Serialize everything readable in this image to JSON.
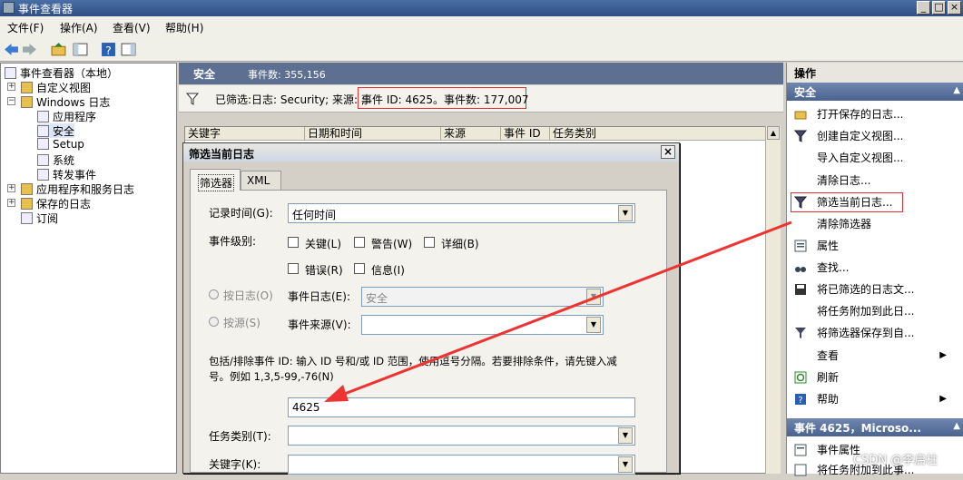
{
  "window": {
    "title": "事件查看器"
  },
  "menu": [
    "文件(F)",
    "操作(A)",
    "查看(V)",
    "帮助(H)"
  ],
  "tree": {
    "root": "事件查看器（本地）",
    "custom_views": "自定义视图",
    "windows_logs": "Windows 日志",
    "application": "应用程序",
    "security": "安全",
    "setup": "Setup",
    "system": "系统",
    "forwarded": "转发事件",
    "app_service_logs": "应用程序和服务日志",
    "saved_logs": "保存的日志",
    "subscriptions": "订阅"
  },
  "center": {
    "section_title": "安全",
    "event_count_label": "事件数: 355,156",
    "filter_text": "已筛选:日志: Security; 来源: ;",
    "filter_highlight": "事件 ID: 4625。事件数: 177,007",
    "columns": [
      "关键字",
      "日期和时间",
      "来源",
      "事件 ID",
      "任务类别"
    ]
  },
  "dialog": {
    "title": "筛选当前日志",
    "tabs": [
      "筛选器",
      "XML"
    ],
    "logged_label": "记录时间(G):",
    "logged_value": "任何时间",
    "level_label": "事件级别:",
    "levels": [
      "关键(L)",
      "警告(W)",
      "详细(B)",
      "错误(R)",
      "信息(I)"
    ],
    "by_log": "按日志(O)",
    "event_log_label": "事件日志(E):",
    "event_log_value": "安全",
    "by_source": "按源(S)",
    "event_source_label": "事件来源(V):",
    "event_source_value": "",
    "id_hint_line1": "包括/排除事件 ID: 输入 ID 号和/或 ID 范围，使用逗号分隔。若要排除条件，请先键入减",
    "id_hint_line2": "号。例如 1,3,5-99,-76(N)",
    "event_id_value": "4625",
    "task_category_label": "任务类别(T):",
    "keywords_label": "关键字(K):"
  },
  "actions": {
    "header": "操作",
    "section1": "安全",
    "items": [
      "打开保存的日志...",
      "创建自定义视图...",
      "导入自定义视图...",
      "清除日志...",
      "筛选当前日志...",
      "清除筛选器",
      "属性",
      "查找...",
      "将已筛选的日志文...",
      "将任务附加到此日...",
      "将筛选器保存到自...",
      "查看",
      "刷新",
      "帮助"
    ],
    "section2": "事件 4625，Microso...",
    "items2": [
      "事件属性",
      "将任务附加到此事..."
    ]
  },
  "watermark": "CSDN @李启柱",
  "colors": {
    "highlight_box": "#e03030",
    "arrow": "#ee3333",
    "section_header": "#4a638f"
  }
}
